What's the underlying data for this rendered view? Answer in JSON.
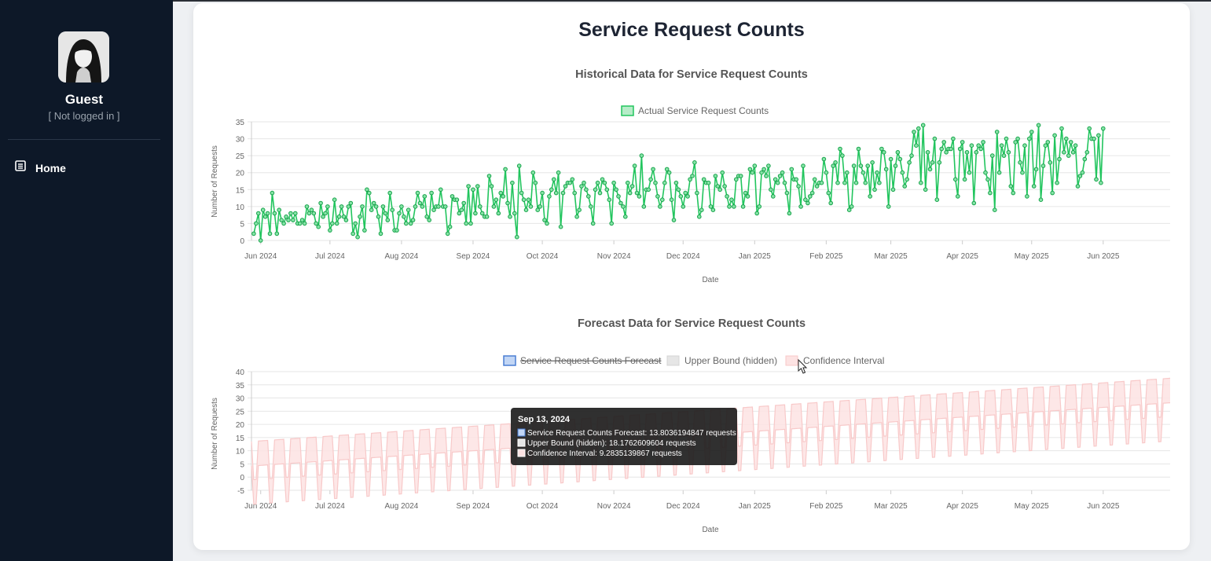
{
  "sidebar": {
    "user_name": "Guest",
    "user_status": "[ Not logged in ]",
    "nav": [
      {
        "label": "Home",
        "icon": "document-icon"
      }
    ]
  },
  "page": {
    "title": "Service Request Counts"
  },
  "colors": {
    "sidebar_bg": "#0d1828",
    "actual_line": "#22c55e",
    "forecast": "#4a7fd4",
    "upper_bound": "#c9c9c9",
    "confidence": "#f8c9c9",
    "tooltip_bg": "#1a1a1a"
  },
  "chart_data": [
    {
      "type": "line",
      "title": "Historical Data for Service Request Counts",
      "xlabel": "Date",
      "ylabel": "Number of Requests",
      "x_tick_labels": [
        "Jun 2024",
        "Jul 2024",
        "Aug 2024",
        "Sep 2024",
        "Oct 2024",
        "Nov 2024",
        "Dec 2024",
        "Jan 2025",
        "Feb 2025",
        "Mar 2025",
        "Apr 2025",
        "May 2025",
        "Jun 2025"
      ],
      "y_ticks": [
        0,
        5,
        10,
        15,
        20,
        25,
        30,
        35
      ],
      "ylim": [
        0,
        35
      ],
      "xlim": [
        "2024-05-28",
        "2025-06-30"
      ],
      "legend": {
        "position": "top",
        "entries": [
          "Actual Service Request Counts"
        ]
      },
      "grid": true,
      "series": [
        {
          "name": "Actual Service Request Counts",
          "x_start": "2024-05-29",
          "x_step": "1 day",
          "values": [
            2,
            5,
            8,
            0,
            9,
            7,
            8,
            2,
            14,
            8,
            2,
            9,
            6,
            5,
            7,
            6,
            8,
            6,
            8,
            5,
            5,
            6,
            5,
            10,
            8,
            9,
            8,
            5,
            4,
            11,
            7,
            8,
            10,
            3,
            5,
            12,
            5,
            7,
            10,
            7,
            6,
            10,
            11,
            2,
            5,
            1,
            7,
            10,
            3,
            15,
            14,
            9,
            11,
            10,
            7,
            2,
            10,
            8,
            6,
            14,
            9,
            3,
            3,
            8,
            10,
            7,
            5,
            9,
            5,
            6,
            10,
            14,
            11,
            10,
            13,
            7,
            6,
            14,
            9,
            10,
            10,
            15,
            10,
            10,
            2,
            4,
            13,
            12,
            12,
            8,
            9,
            11,
            5,
            16,
            5,
            15,
            8,
            16,
            10,
            8,
            7,
            7,
            19,
            16,
            10,
            12,
            8,
            14,
            13,
            21,
            11,
            7,
            17,
            8,
            1,
            22,
            14,
            12,
            9,
            12,
            10,
            20,
            17,
            9,
            10,
            14,
            6,
            5,
            13,
            15,
            18,
            14,
            20,
            4,
            14,
            16,
            17,
            17,
            18,
            14,
            7,
            9,
            16,
            17,
            15,
            13,
            10,
            5,
            15,
            17,
            14,
            18,
            17,
            15,
            12,
            5,
            17,
            15,
            13,
            11,
            10,
            7,
            17,
            14,
            16,
            22,
            14,
            13,
            25,
            10,
            15,
            15,
            18,
            21,
            17,
            13,
            10,
            12,
            17,
            21,
            20,
            12,
            6,
            17,
            15,
            13,
            10,
            14,
            13,
            18,
            19,
            23,
            14,
            7,
            9,
            18,
            17,
            17,
            10,
            9,
            19,
            16,
            15,
            20,
            16,
            13,
            10,
            12,
            10,
            18,
            19,
            19,
            10,
            14,
            13,
            21,
            20,
            22,
            8,
            10,
            20,
            21,
            19,
            22,
            15,
            13,
            18,
            17,
            19,
            20,
            17,
            14,
            8,
            21,
            18,
            18,
            16,
            10,
            22,
            12,
            11,
            13,
            14,
            18,
            16,
            17,
            17,
            24,
            20,
            14,
            11,
            22,
            23,
            17,
            27,
            25,
            17,
            20,
            9,
            10,
            22,
            17,
            27,
            22,
            20,
            17,
            22,
            13,
            23,
            15,
            20,
            17,
            27,
            26,
            21,
            10,
            24,
            15,
            22,
            26,
            24,
            20,
            16,
            18,
            23,
            25,
            32,
            28,
            33,
            17,
            34,
            15,
            26,
            21,
            23,
            30,
            12,
            23,
            27,
            29,
            26,
            27,
            27,
            30,
            18,
            13,
            27,
            29,
            18,
            26,
            20,
            28,
            11,
            26,
            28,
            27,
            29,
            20,
            18,
            14,
            25,
            9,
            32,
            20,
            28,
            25,
            30,
            26,
            16,
            14,
            29,
            30,
            23,
            20,
            28,
            13,
            30,
            32,
            16,
            21,
            34,
            12,
            22,
            28,
            29,
            23,
            14,
            31,
            17,
            24,
            33,
            26,
            30,
            25,
            29,
            26,
            28,
            16,
            19,
            20,
            24,
            26,
            33,
            30,
            30,
            18,
            31,
            17,
            33
          ]
        }
      ]
    },
    {
      "type": "area",
      "title": "Forecast Data for Service Request Counts",
      "xlabel": "Date",
      "ylabel": "Number of Requests",
      "x_tick_labels": [
        "Jun 2024",
        "Jul 2024",
        "Aug 2024",
        "Sep 2024",
        "Oct 2024",
        "Nov 2024",
        "Dec 2024",
        "Jan 2025",
        "Feb 2025",
        "Mar 2025",
        "Apr 2025",
        "May 2025",
        "Jun 2025"
      ],
      "y_ticks": [
        -5,
        0,
        5,
        10,
        15,
        20,
        25,
        30,
        35,
        40
      ],
      "ylim": [
        -5,
        40
      ],
      "xlim": [
        "2024-05-28",
        "2025-06-30"
      ],
      "legend": {
        "position": "top",
        "entries": [
          "Service Request Counts Forecast",
          "Upper Bound (hidden)",
          "Confidence Interval"
        ],
        "hidden": [
          "Service Request Counts Forecast"
        ]
      },
      "grid": true,
      "pattern": "weekly cycle: upper bound about 4.5 above the trend on five days and about 10 below it on the other two; lower bound about 9.3 below the upper bound",
      "trend": [
        {
          "date": "2024-05-28",
          "value": 9
        },
        {
          "date": "2025-06-30",
          "value": 33
        }
      ],
      "tooltip": {
        "title": "Sep 13, 2024",
        "lines": [
          "Service Request Counts Forecast: 13.8036194847 requests",
          "Upper Bound (hidden): 18.1762609604 requests",
          "Confidence Interval: 9.2835139867 requests"
        ]
      }
    }
  ]
}
